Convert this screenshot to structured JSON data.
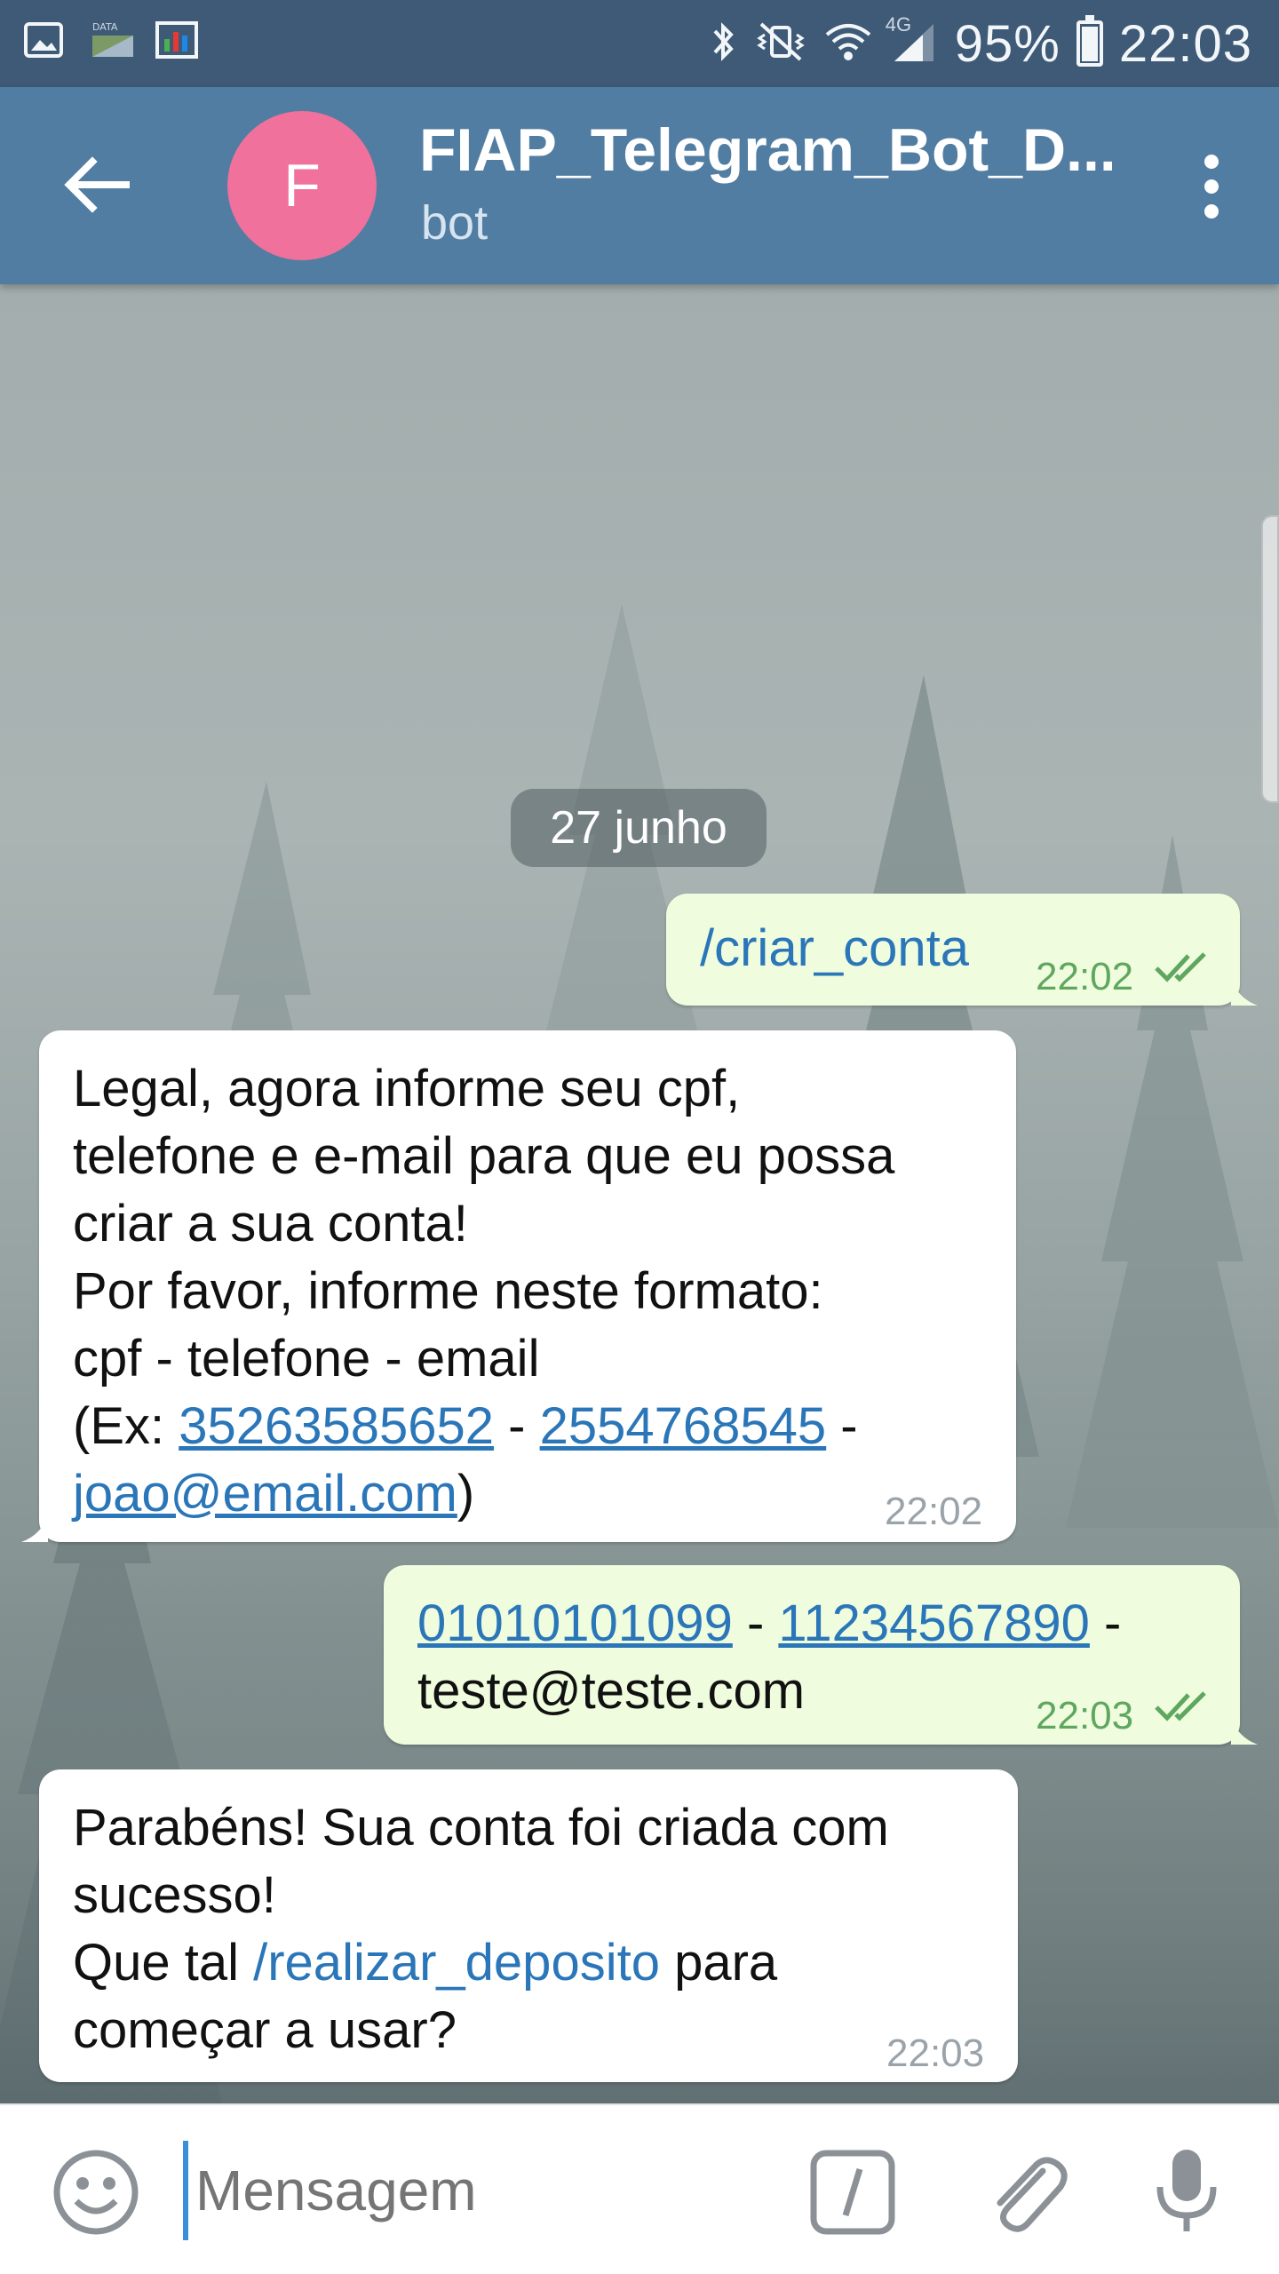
{
  "status_bar": {
    "battery": "95%",
    "battery_level": 0.95,
    "time": "22:03",
    "network": "4G"
  },
  "header": {
    "avatar_letter": "F",
    "title": "FIAP_Telegram_Bot_D...",
    "subtitle": "bot",
    "avatar_color": "#f0719b",
    "bar_color": "#517da2"
  },
  "chat": {
    "date": "27 junho",
    "messages": [
      {
        "dir": "out",
        "text": "/criar_conta",
        "time": "22:02"
      },
      {
        "dir": "in",
        "lines": [
          "Legal, agora informe seu cpf,",
          "telefone e e-mail para que eu possa",
          "criar a sua conta!",
          "Por favor, informe neste formato:",
          "cpf - telefone - email"
        ],
        "ex_prefix": "(Ex: ",
        "ex_phone1": "35263585652",
        "ex_sep1": " - ",
        "ex_phone2": "2554768545",
        "ex_sep2": " -",
        "ex_email": "joao@email.com",
        "ex_close": ")",
        "time": "22:02"
      },
      {
        "dir": "out",
        "num1": "01010101099",
        "sep1": " - ",
        "num2": "11234567890",
        "sep2": " -",
        "email": "teste@teste.com",
        "time": "22:03"
      },
      {
        "dir": "in",
        "line1": "Parabéns! Sua conta foi criada com",
        "line2": "sucesso!",
        "line3_pre": "Que tal ",
        "line3_cmd": "/realizar_deposito",
        "line3_post": " para",
        "line4": "começar a usar?",
        "time": "22:03"
      }
    ]
  },
  "input_bar": {
    "placeholder": "Mensagem"
  },
  "colors": {
    "outgoing_bubble": "#effdde",
    "incoming_bubble": "#ffffff",
    "link": "#2a76b8",
    "read_check": "#5fa75f"
  }
}
